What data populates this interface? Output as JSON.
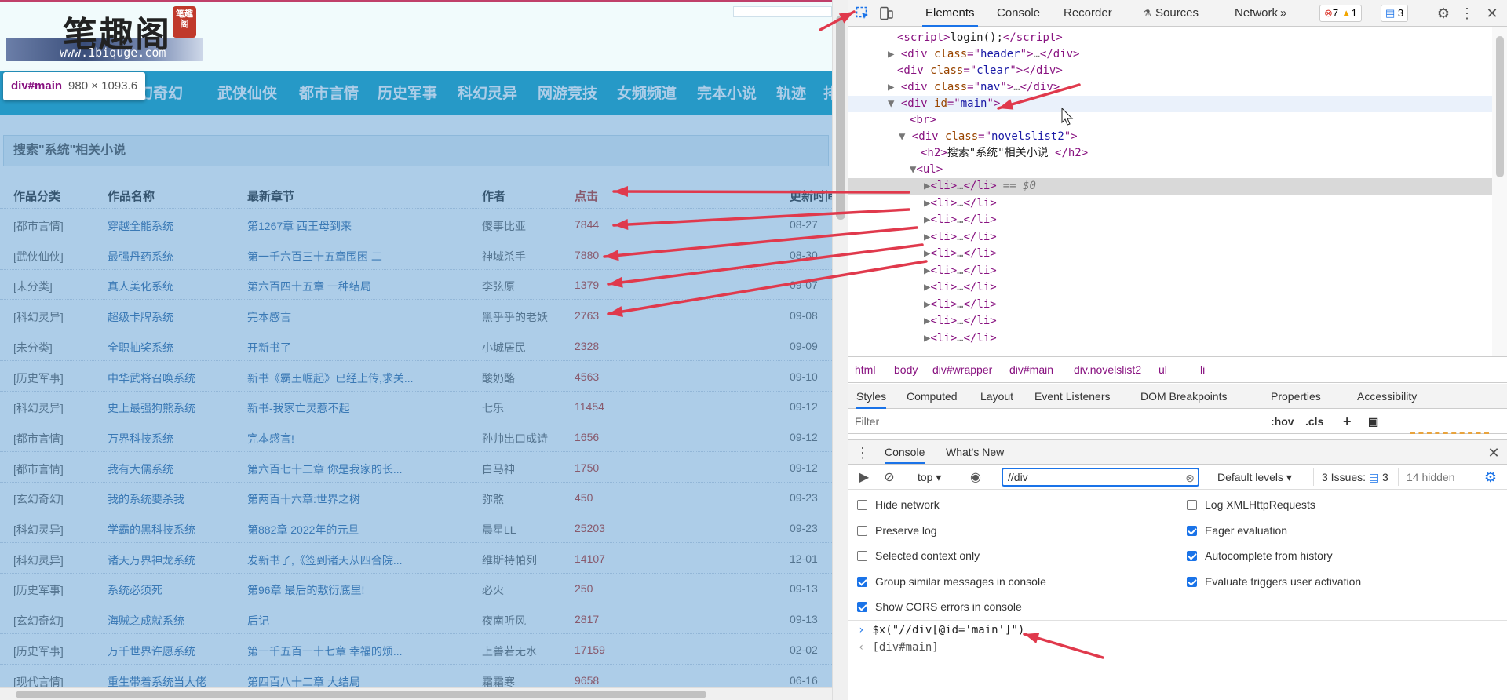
{
  "page": {
    "logo": {
      "title": "笔趣阁",
      "url": "www.1biquge.com",
      "seal": "笔趣阁"
    },
    "nav": [
      "玄幻奇幻",
      "武侠仙侠",
      "都市言情",
      "历史军事",
      "科幻灵异",
      "网游竞技",
      "女频频道",
      "完本小说",
      "轨迹",
      "排"
    ],
    "tooltip": {
      "tag": "div#main",
      "size": "980 × 1093.6"
    },
    "heading": "搜索\"系统\"相关小说",
    "columns": [
      "作品分类",
      "作品名称",
      "最新章节",
      "作者",
      "点击",
      "更新时间"
    ],
    "rows": [
      [
        "[都市言情]",
        "穿越全能系统",
        "第1267章 西王母到来",
        "傻事比亚",
        "7844",
        "08-27"
      ],
      [
        "[武侠仙侠]",
        "最强丹药系统",
        "第一千六百三十五章围困 二",
        "神域杀手",
        "7880",
        "08-30"
      ],
      [
        "[未分类]",
        "真人美化系统",
        "第六百四十五章 一种结局",
        "李弦原",
        "1379",
        "09-07"
      ],
      [
        "[科幻灵异]",
        "超级卡牌系统",
        "完本感言",
        "黑乎乎的老妖",
        "2763",
        "09-08"
      ],
      [
        "[未分类]",
        "全职抽奖系统",
        "开新书了",
        "小城居民",
        "2328",
        "09-09"
      ],
      [
        "[历史军事]",
        "中华武将召唤系统",
        "新书《霸王崛起》已经上传,求关...",
        "酸奶酪",
        "4563",
        "09-10"
      ],
      [
        "[科幻灵异]",
        "史上最强狗熊系统",
        "新书-我家亡灵惹不起",
        "七乐",
        "11454",
        "09-12"
      ],
      [
        "[都市言情]",
        "万界科技系统",
        "完本感言!",
        "孙帅出口成诗",
        "1656",
        "09-12"
      ],
      [
        "[都市言情]",
        "我有大儒系统",
        "第六百七十二章 你是我家的长...",
        "白马神",
        "1750",
        "09-12"
      ],
      [
        "[玄幻奇幻]",
        "我的系统要杀我",
        "第两百十六章:世界之树",
        "弥煞",
        "450",
        "09-23"
      ],
      [
        "[科幻灵异]",
        "学霸的黑科技系统",
        "第882章 2022年的元旦",
        "晨星LL",
        "25203",
        "09-23"
      ],
      [
        "[科幻灵异]",
        "诸天万界神龙系统",
        "发新书了,《签到诸天从四合院...",
        "维斯特帕列",
        "14107",
        "12-01"
      ],
      [
        "[历史军事]",
        "系统必须死",
        "第96章 最后的敷衍底里!",
        "必火",
        "250",
        "09-13"
      ],
      [
        "[玄幻奇幻]",
        "海贼之成就系统",
        "后记",
        "夜南听风",
        "2817",
        "09-13"
      ],
      [
        "[历史军事]",
        "万千世界许愿系统",
        "第一千五百一十七章 幸福的烦...",
        "上善若无水",
        "17159",
        "02-02"
      ],
      [
        "[现代言情]",
        "重生带着系统当大佬",
        "第四百八十二章 大结局",
        "霜霜寒",
        "9658",
        "06-16"
      ]
    ]
  },
  "devtools": {
    "tabs": [
      "Elements",
      "Console",
      "Recorder",
      "Sources",
      "Network"
    ],
    "more": "»",
    "badges": {
      "errors": "7",
      "warnings": "1",
      "messages": "3"
    },
    "dom": {
      "script_text": "login();",
      "c_header": "header",
      "c_clear": "clear",
      "c_nav": "nav",
      "main_id": "main",
      "c_novels": "novelslist2",
      "h2_text": "搜索\"系统\"相关小说 ",
      "selected_suffix": "== $0"
    },
    "breadcrumbs": [
      "html",
      "body",
      "div#wrapper",
      "div#main",
      "div.novelslist2",
      "ul",
      "li"
    ],
    "style_tabs": [
      "Styles",
      "Computed",
      "Layout",
      "Event Listeners",
      "DOM Breakpoints",
      "Properties",
      "Accessibility"
    ],
    "filter_placeholder": "Filter",
    "hov": ":hov",
    "cls": ".cls",
    "drawer_tabs": [
      "Console",
      "What's New"
    ],
    "console": {
      "context": "top",
      "filter_value": "//div",
      "levels": "Default levels",
      "issues": "3 Issues:",
      "issues_count": "3",
      "hidden": "14 hidden",
      "left_options": [
        {
          "label": "Hide network",
          "checked": false
        },
        {
          "label": "Preserve log",
          "checked": false
        },
        {
          "label": "Selected context only",
          "checked": false
        },
        {
          "label": "Group similar messages in console",
          "checked": true
        },
        {
          "label": "Show CORS errors in console",
          "checked": true
        }
      ],
      "right_options": [
        {
          "label": "Log XMLHttpRequests",
          "checked": false
        },
        {
          "label": "Eager evaluation",
          "checked": true
        },
        {
          "label": "Autocomplete from history",
          "checked": true
        },
        {
          "label": "Evaluate triggers user activation",
          "checked": true
        }
      ],
      "input": "$x(\"//div[@id='main']\")",
      "result": "[div#main]"
    }
  },
  "colors": {
    "accent": "#1a73e8",
    "nav": "#17a5c6",
    "arrow": "#e0394c",
    "overlay": "#3c87c8"
  }
}
